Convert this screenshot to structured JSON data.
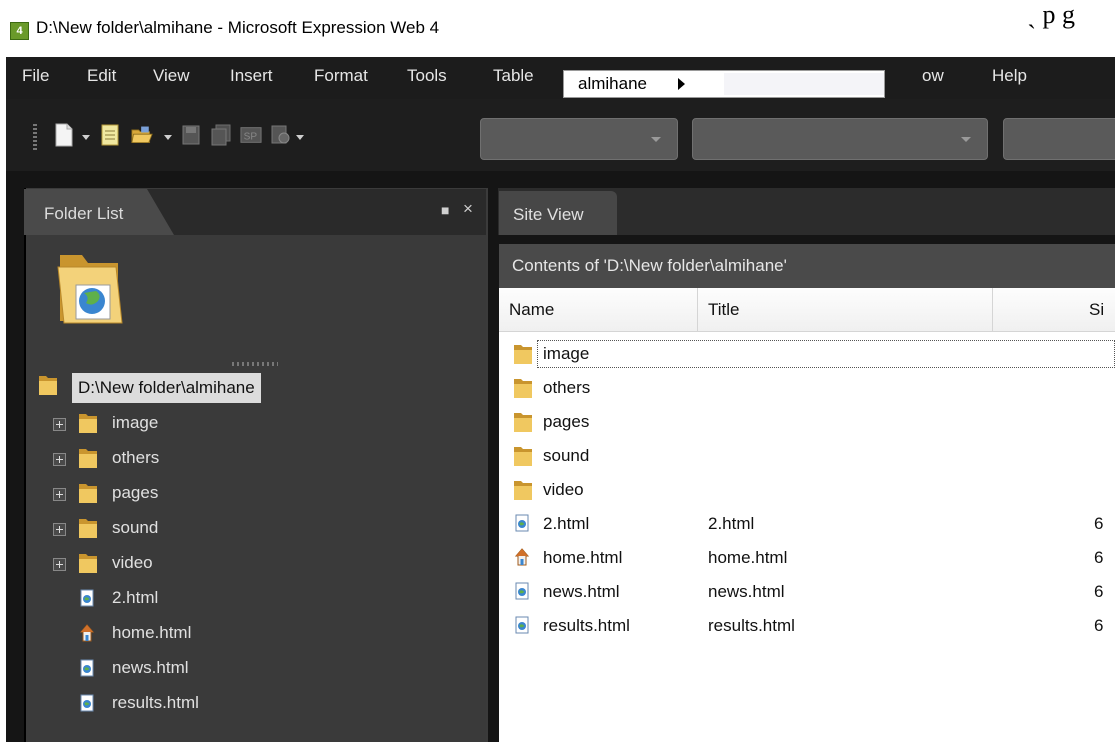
{
  "window": {
    "title": "D:\\New folder\\almihane - Microsoft Expression Web 4",
    "corner_text": "ˎ p g",
    "app_icon_label": "4"
  },
  "menu": {
    "items": [
      "File",
      "Edit",
      "View",
      "Insert",
      "Format",
      "Tools",
      "Table",
      "ow",
      "Help"
    ]
  },
  "breadcrumb": {
    "site": "almihane"
  },
  "folder_panel": {
    "title": "Folder List",
    "root": "D:\\New folder\\almihane",
    "folders": [
      "image",
      "others",
      "pages",
      "sound",
      "video"
    ],
    "files": [
      "2.html",
      "home.html",
      "news.html",
      "results.html"
    ]
  },
  "site_view": {
    "tab": "Site View",
    "contents_label": "Contents of 'D:\\New folder\\almihane'",
    "columns": [
      "Name",
      "Title",
      "Si"
    ],
    "rows": [
      {
        "name": "image",
        "title": "",
        "size": "",
        "kind": "folder"
      },
      {
        "name": "others",
        "title": "",
        "size": "",
        "kind": "folder"
      },
      {
        "name": "pages",
        "title": "",
        "size": "",
        "kind": "folder"
      },
      {
        "name": "sound",
        "title": "",
        "size": "",
        "kind": "folder"
      },
      {
        "name": "video",
        "title": "",
        "size": "",
        "kind": "folder"
      },
      {
        "name": "2.html",
        "title": "2.html",
        "size": "6",
        "kind": "page"
      },
      {
        "name": "home.html",
        "title": "home.html",
        "size": "6",
        "kind": "home"
      },
      {
        "name": "news.html",
        "title": "news.html",
        "size": "6",
        "kind": "page"
      },
      {
        "name": "results.html",
        "title": "results.html",
        "size": "6",
        "kind": "page"
      }
    ]
  },
  "icons": {
    "folder": "folder-icon",
    "page": "html-page-icon",
    "home": "home-page-icon",
    "pin": "pin-icon",
    "close": "close-icon"
  },
  "colors": {
    "chrome_dark": "#1c1c1c",
    "panel": "#3a3a3a",
    "folder_yellow": "#e8b94a",
    "accent_green": "#6a9a2a"
  }
}
